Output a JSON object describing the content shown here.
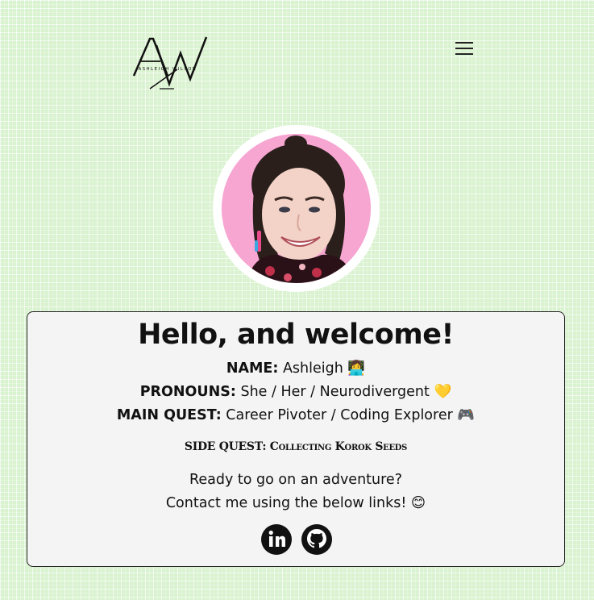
{
  "header": {
    "logo_text": "Ashleigh Wilson",
    "logo_initials": "AW",
    "menu_icon": "hamburger-menu-icon"
  },
  "profile": {
    "avatar_alt": "Ashleigh avatar"
  },
  "intro": {
    "title": "Hello, and welcome!",
    "name_label": "NAME:",
    "name_value": "Ashleigh 👩‍💻",
    "pronouns_label": "PRONOUNS:",
    "pronouns_value": "She / Her / Neurodivergent 💛",
    "quest_label": "MAIN QUEST:",
    "quest_value": "Career Pivoter / Coding Explorer 🎮",
    "side_quest": "SIDE QUEST: Collecting Korok Seeds",
    "cta_line1": "Ready to go on an adventure?",
    "cta_line2": "Contact me using the below links! 😊"
  },
  "social": {
    "links": [
      {
        "icon": "linkedin-icon"
      },
      {
        "icon": "github-icon"
      }
    ]
  },
  "colors": {
    "background": "#d9f2cf",
    "card": "#f4f4f4",
    "avatar_bg": "#f7a6d2"
  }
}
